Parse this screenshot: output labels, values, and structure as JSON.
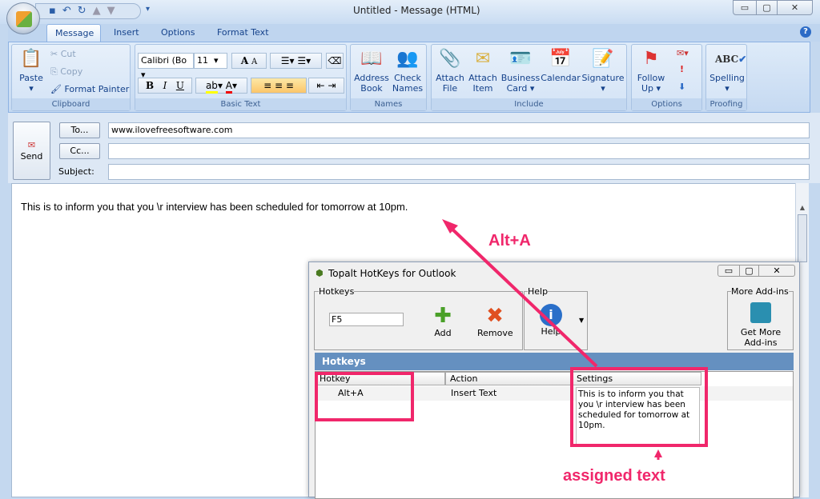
{
  "window": {
    "title": "Untitled - Message (HTML)",
    "minimize": "▭",
    "restore": "▢",
    "close": "✕"
  },
  "tabs": [
    {
      "label": "Message"
    },
    {
      "label": "Insert"
    },
    {
      "label": "Options"
    },
    {
      "label": "Format Text"
    }
  ],
  "ribbon": {
    "clipboard": {
      "label": "Clipboard",
      "paste": "Paste",
      "cut": "Cut",
      "copy": "Copy",
      "format_painter": "Format Painter"
    },
    "basic_text": {
      "label": "Basic Text",
      "font": "Calibri (Bo",
      "size": "11",
      "bold": "B",
      "italic": "I",
      "underline": "U",
      "grow": "A",
      "shrink": "A",
      "font_color": "A"
    },
    "names": {
      "label": "Names",
      "address_book": [
        "Address",
        "Book"
      ],
      "check_names": [
        "Check",
        "Names"
      ]
    },
    "include": {
      "label": "Include",
      "attach_file": [
        "Attach",
        "File"
      ],
      "attach_item": [
        "Attach",
        "Item"
      ],
      "business_card": [
        "Business",
        "Card ▾"
      ],
      "calendar": "Calendar",
      "signature": "Signature"
    },
    "options": {
      "label": "Options",
      "follow_up": [
        "Follow",
        "Up ▾"
      ]
    },
    "proofing": {
      "label": "Proofing",
      "spelling": "Spelling",
      "abc": "ABC"
    }
  },
  "header": {
    "send": "Send",
    "to": "To...",
    "cc": "Cc...",
    "subject": "Subject:",
    "to_value": "www.ilovefreesoftware.com",
    "cc_value": "",
    "subject_value": ""
  },
  "body": {
    "text": "This is to inform you that you \\r  interview has been scheduled for tomorrow at 10pm."
  },
  "dialog": {
    "title": "Topalt HotKeys for Outlook",
    "hotkeys_group": "Hotkeys",
    "hotkey_input": "F5",
    "add": "Add",
    "remove": "Remove",
    "help_group": "Help",
    "help": "Help",
    "more_group": "More Add-ins",
    "get_more": [
      "Get More",
      "Add-ins"
    ],
    "section": "Hotkeys",
    "columns": [
      "Hotkey",
      "Action",
      "Settings"
    ],
    "rows": [
      {
        "hotkey": "Alt+A",
        "action": "Insert Text",
        "settings": "This is to inform you that you \\r  interview has been scheduled for tomorrow at 10pm."
      }
    ]
  },
  "annotations": {
    "alt_a": "Alt+A",
    "assigned": "assigned text"
  },
  "colors": {
    "accent_pink": "#f0276b",
    "section_blue": "#6590c0"
  }
}
